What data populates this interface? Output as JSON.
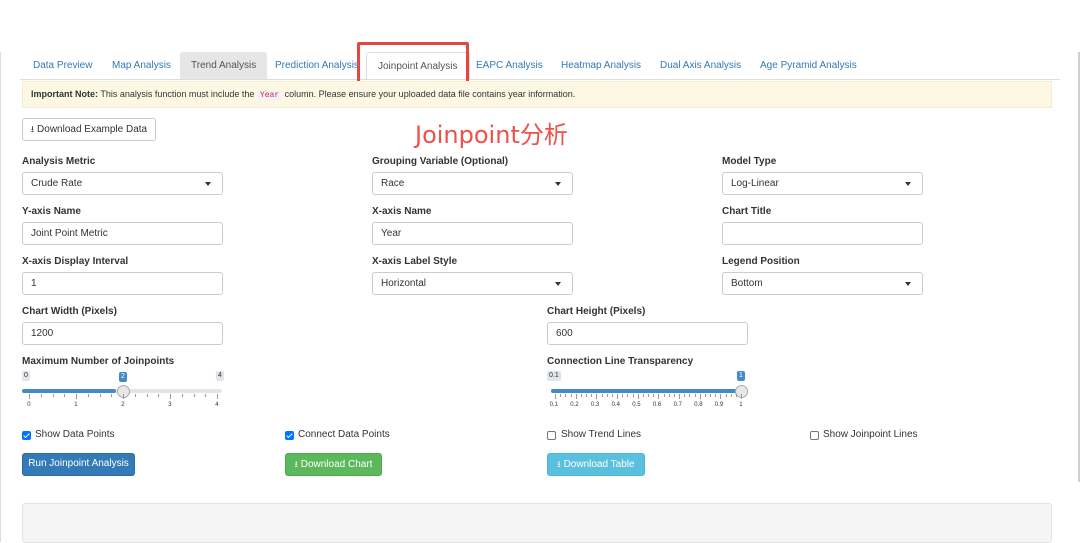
{
  "tabs": [
    {
      "label": "Data Preview"
    },
    {
      "label": "Map Analysis"
    },
    {
      "label": "Trend Analysis"
    },
    {
      "label": "Prediction Analysis"
    },
    {
      "label": "Joinpoint Analysis"
    },
    {
      "label": "EAPC Analysis"
    },
    {
      "label": "Heatmap Analysis"
    },
    {
      "label": "Dual Axis Analysis"
    },
    {
      "label": "Age Pyramid Analysis"
    }
  ],
  "note": {
    "prefix": "Important Note:",
    "text_before": " This analysis function must include the ",
    "code": "Year",
    "text_after": " column. Please ensure your uploaded data file contains year information."
  },
  "download_example_label": "Download Example Data",
  "overlay_title": "Joinpoint分析",
  "form": {
    "analysis_metric": {
      "label": "Analysis Metric",
      "value": "Crude Rate"
    },
    "grouping_variable": {
      "label": "Grouping Variable (Optional)",
      "value": "Race"
    },
    "model_type": {
      "label": "Model Type",
      "value": "Log-Linear"
    },
    "y_axis_name": {
      "label": "Y-axis Name",
      "value": "Joint Point Metric"
    },
    "x_axis_name": {
      "label": "X-axis Name",
      "value": "Year"
    },
    "chart_title": {
      "label": "Chart Title",
      "value": ""
    },
    "x_axis_interval": {
      "label": "X-axis Display Interval",
      "value": "1"
    },
    "x_axis_label_style": {
      "label": "X-axis Label Style",
      "value": "Horizontal"
    },
    "legend_position": {
      "label": "Legend Position",
      "value": "Bottom"
    },
    "chart_width": {
      "label": "Chart Width (Pixels)",
      "value": "1200"
    },
    "chart_height": {
      "label": "Chart Height (Pixels)",
      "value": "600"
    }
  },
  "sliders": {
    "max_joinpoints": {
      "label": "Maximum Number of Joinpoints",
      "min": "0",
      "max": "4",
      "value": "2",
      "fraction": 0.5,
      "ticks": [
        "0",
        "1",
        "2",
        "3",
        "4"
      ]
    },
    "transparency": {
      "label": "Connection Line Transparency",
      "min": "0.1",
      "max": "1",
      "value": "1",
      "fraction": 1.0,
      "ticks": [
        "0.1",
        "0.2",
        "0.3",
        "0.4",
        "0.5",
        "0.6",
        "0.7",
        "0.8",
        "0.9",
        "1"
      ]
    }
  },
  "checkboxes": [
    {
      "label": "Show Data Points",
      "checked": true
    },
    {
      "label": "Connect Data Points",
      "checked": true
    },
    {
      "label": "Show Trend Lines",
      "checked": false
    },
    {
      "label": "Show Joinpoint Lines",
      "checked": false
    }
  ],
  "actions": {
    "run": "Run Joinpoint Analysis",
    "download_chart": "Download Chart",
    "download_table": "Download Table"
  },
  "colors": {
    "primary": "#337ab7",
    "success": "#5cb85c",
    "info": "#5bc0de",
    "highlight": "#e64545",
    "slider": "#428bca"
  }
}
